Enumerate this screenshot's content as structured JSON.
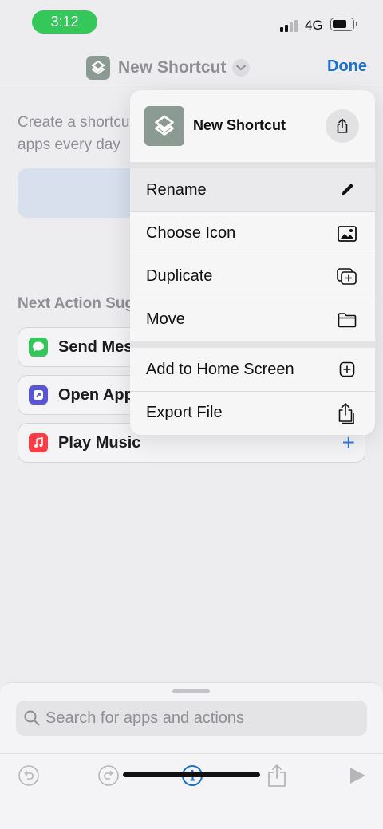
{
  "status_bar": {
    "time": "3:12",
    "network": "4G"
  },
  "nav": {
    "title": "New Shortcut",
    "done_label": "Done"
  },
  "background": {
    "description_line1": "Create a shortcut",
    "description_line2": "apps every day",
    "section_title": "Next Action Suggestions",
    "suggestions": [
      {
        "label": "Send Message",
        "icon": "messages-icon",
        "color": "#34c759"
      },
      {
        "label": "Open App",
        "icon": "open-app-icon",
        "color": "#5856d6"
      },
      {
        "label": "Play Music",
        "icon": "music-icon",
        "color": "#fc3c44"
      }
    ],
    "add_symbol": "+"
  },
  "menu": {
    "header_title": "New Shortcut",
    "items": [
      {
        "label": "Rename",
        "icon": "pencil-icon"
      },
      {
        "label": "Choose Icon",
        "icon": "photo-icon"
      },
      {
        "label": "Duplicate",
        "icon": "duplicate-icon"
      },
      {
        "label": "Move",
        "icon": "folder-icon"
      },
      {
        "label": "Add to Home Screen",
        "icon": "add-square-icon"
      },
      {
        "label": "Export File",
        "icon": "share-icon"
      }
    ]
  },
  "bottom": {
    "search_placeholder": "Search for apps and actions",
    "toolbar": [
      "undo-icon",
      "redo-icon",
      "info-icon",
      "share-icon",
      "play-icon"
    ]
  },
  "colors": {
    "accent": "#1d6fd1",
    "time_pill": "#34c759",
    "shortcut_icon_bg": "#8c9a94"
  }
}
